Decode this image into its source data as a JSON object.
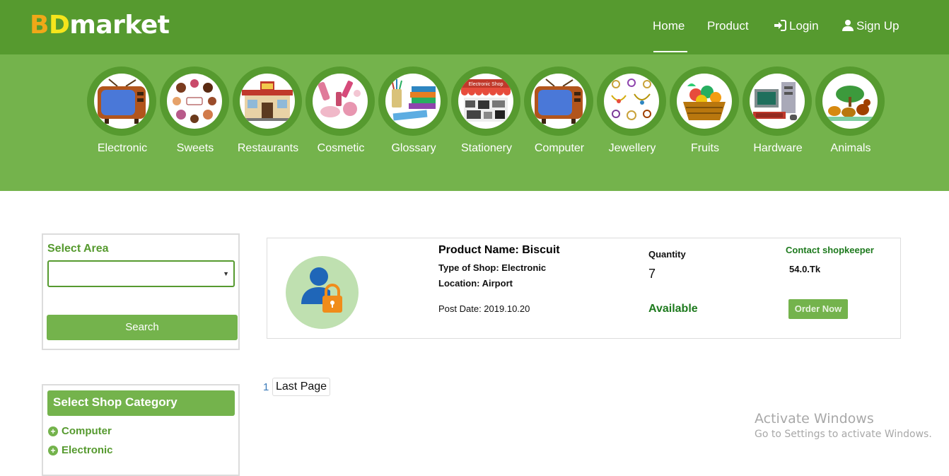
{
  "brand": {
    "b": "B",
    "d": "D",
    "rest": "market"
  },
  "nav": {
    "home": "Home",
    "product": "Product",
    "login": "Login",
    "signup": "Sign Up"
  },
  "categories": [
    {
      "label": "Electronic",
      "icon": "tv-icon"
    },
    {
      "label": "Sweets",
      "icon": "sweets-icon"
    },
    {
      "label": "Restaurants",
      "icon": "restaurant-icon"
    },
    {
      "label": "Cosmetic",
      "icon": "cosmetic-icon"
    },
    {
      "label": "Glossary",
      "icon": "books-icon"
    },
    {
      "label": "Stationery",
      "icon": "electronic-shop-icon"
    },
    {
      "label": "Computer",
      "icon": "tv-icon"
    },
    {
      "label": "Jewellery",
      "icon": "jewellery-icon"
    },
    {
      "label": "Fruits",
      "icon": "fruit-basket-icon"
    },
    {
      "label": "Hardware",
      "icon": "hardware-icon"
    },
    {
      "label": "Animals",
      "icon": "animals-icon"
    }
  ],
  "electronic_shop_sign": "Electronic Shop",
  "sidebar": {
    "area_title": "Select Area",
    "area_value": "",
    "search_label": "Search",
    "shop_category_title": "Select Shop Category",
    "shop_categories": [
      "Computer",
      "Electronic"
    ]
  },
  "product": {
    "name": "Product Name: Biscuit",
    "type": "Type of Shop: Electronic",
    "location": "Location: Airport",
    "post_date": "Post Date: 2019.10.20",
    "quantity_label": "Quantity",
    "quantity": "7",
    "availability": "Available",
    "contact": "Contact shopkeeper",
    "price": "54.0.Tk",
    "order_label": "Order Now"
  },
  "pagination": {
    "current": "1",
    "last": "Last Page"
  },
  "watermark": {
    "title": "Activate Windows",
    "subtitle": "Go to Settings to activate Windows."
  },
  "colors": {
    "nav_green": "#569a2f",
    "band_green": "#74b34c",
    "available_green": "#1e7a1e"
  }
}
